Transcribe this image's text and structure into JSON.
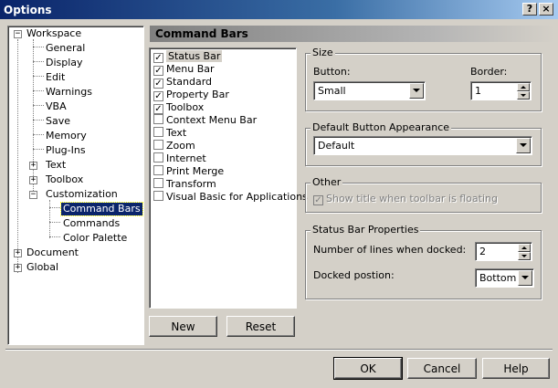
{
  "window": {
    "title": "Options",
    "help_button": "?",
    "close_button": "×"
  },
  "tree": {
    "workspace": "Workspace",
    "general": "General",
    "display": "Display",
    "edit": "Edit",
    "warnings": "Warnings",
    "vba": "VBA",
    "save": "Save",
    "memory": "Memory",
    "plugins": "Plug-Ins",
    "text": "Text",
    "toolbox": "Toolbox",
    "customization": "Customization",
    "command_bars": "Command Bars",
    "commands": "Commands",
    "color_palette": "Color Palette",
    "document": "Document",
    "global": "Global",
    "expanded_sign": "−",
    "collapsed_sign": "+"
  },
  "panel": {
    "header": "Command Bars"
  },
  "command_list": [
    {
      "label": "Status Bar",
      "checked": true
    },
    {
      "label": "Menu Bar",
      "checked": true
    },
    {
      "label": "Standard",
      "checked": true
    },
    {
      "label": "Property Bar",
      "checked": true
    },
    {
      "label": "Toolbox",
      "checked": true
    },
    {
      "label": "Context Menu Bar",
      "checked": false
    },
    {
      "label": "Text",
      "checked": false
    },
    {
      "label": "Zoom",
      "checked": false
    },
    {
      "label": "Internet",
      "checked": false
    },
    {
      "label": "Print Merge",
      "checked": false
    },
    {
      "label": "Transform",
      "checked": false
    },
    {
      "label": "Visual Basic for Applications",
      "checked": false
    }
  ],
  "list_buttons": {
    "new_label": "New",
    "reset_label": "Reset"
  },
  "size": {
    "title": "Size",
    "button_label": "Button:",
    "button_value": "Small",
    "border_label": "Border:",
    "border_value": "1"
  },
  "default_appearance": {
    "title": "Default Button Appearance",
    "value": "Default"
  },
  "other": {
    "title": "Other",
    "show_title_label": "Show title when toolbar is floating",
    "show_title_checked": true
  },
  "status_bar": {
    "title": "Status Bar Properties",
    "lines_label": "Number of lines when docked:",
    "lines_value": "2",
    "position_label": "Docked postion:",
    "position_value": "Bottom"
  },
  "dialog_buttons": {
    "ok": "OK",
    "cancel": "Cancel",
    "help": "Help"
  }
}
